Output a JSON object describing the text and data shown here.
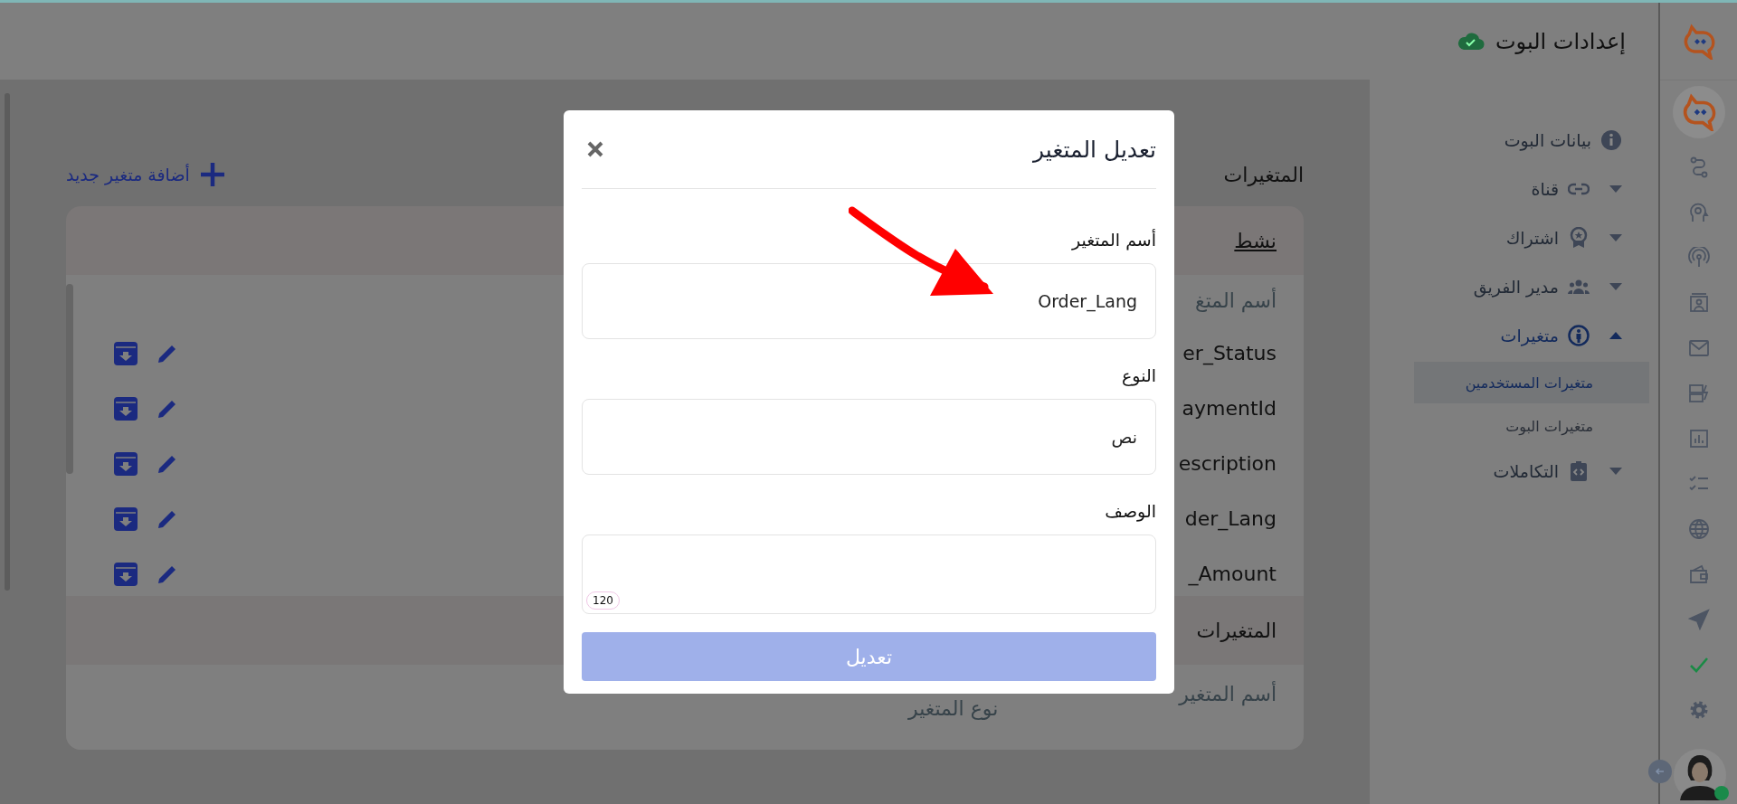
{
  "header": {
    "title": "إعدادات البوت",
    "saved": true
  },
  "rail": {
    "items": [
      {
        "kind": "bot",
        "selected": true
      },
      {
        "kind": "flow",
        "selected": false
      },
      {
        "kind": "brain",
        "selected": false
      },
      {
        "kind": "broadcast",
        "selected": false
      },
      {
        "kind": "contact",
        "selected": false
      },
      {
        "kind": "mail",
        "selected": false
      },
      {
        "kind": "storage",
        "selected": false
      },
      {
        "kind": "chart",
        "selected": false
      },
      {
        "kind": "checklist",
        "selected": false
      },
      {
        "kind": "globe",
        "selected": false
      },
      {
        "kind": "wallet",
        "selected": false
      },
      {
        "kind": "send",
        "selected": false
      },
      {
        "kind": "check",
        "selected": false
      },
      {
        "kind": "settings",
        "selected": false
      }
    ],
    "online": true
  },
  "sidebar": {
    "items": [
      {
        "label": "بيانات البوت",
        "expandable": false,
        "expanded": false,
        "active": false
      },
      {
        "label": "قناة",
        "expandable": true,
        "expanded": false,
        "active": false
      },
      {
        "label": "اشتراك",
        "expandable": true,
        "expanded": false,
        "active": false
      },
      {
        "label": "مدير الفريق",
        "expandable": true,
        "expanded": false,
        "active": false
      },
      {
        "label": "متغيرات",
        "expandable": true,
        "expanded": true,
        "active": true,
        "children": [
          {
            "label": "متغيرات المستخدمين",
            "selected": true
          },
          {
            "label": "متغيرات البوت",
            "selected": false
          }
        ]
      },
      {
        "label": "التكاملات",
        "expandable": true,
        "expanded": false,
        "active": false
      }
    ]
  },
  "main": {
    "title": "المتغيرات",
    "add_button": "أضافة متغير جديد",
    "card": {
      "tab": "نشط",
      "column": "أسم المتغ",
      "rows": [
        {
          "name": "er_Status"
        },
        {
          "name": "aymentId"
        },
        {
          "name": "escription"
        },
        {
          "name": "der_Lang"
        },
        {
          "name": "_Amount"
        }
      ],
      "section": {
        "title": "المتغيرات",
        "columns": [
          "أسم المتغير",
          "نوع المتغير"
        ]
      }
    }
  },
  "dialog": {
    "title": "تعديل المتغير",
    "fields": [
      {
        "kind": "input",
        "label": "أسم المتغير",
        "value": "Order_Lang",
        "annotated": true
      },
      {
        "kind": "input",
        "label": "النوع",
        "value": "نص",
        "annotated": false
      },
      {
        "kind": "textarea",
        "label": "الوصف",
        "counter": "120",
        "annotated": false
      }
    ],
    "submit": {
      "label": "تعديل",
      "disabled": true
    }
  }
}
